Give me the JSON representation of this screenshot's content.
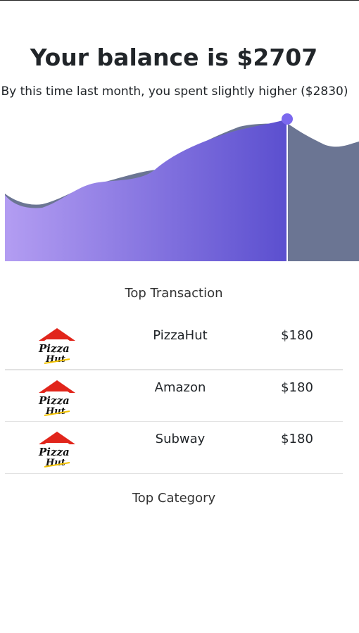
{
  "balance": {
    "title": "Your balance is $2707",
    "subtitle": "By this time last month, you spent slightly higher ($2830)"
  },
  "colors": {
    "purple_light": "#b39df2",
    "purple_dark": "#5b4fcf",
    "slate": "#6b7593",
    "marker": "#7b68ee"
  },
  "top_transaction": {
    "heading": "Top Transaction",
    "items": [
      {
        "name": "PizzaHut",
        "amount": "$180",
        "logo": "pizza-hut-logo"
      },
      {
        "name": "Amazon",
        "amount": "$180",
        "logo": "pizza-hut-logo"
      },
      {
        "name": "Subway",
        "amount": "$180",
        "logo": "pizza-hut-logo"
      }
    ]
  },
  "top_category": {
    "heading": "Top Category"
  }
}
